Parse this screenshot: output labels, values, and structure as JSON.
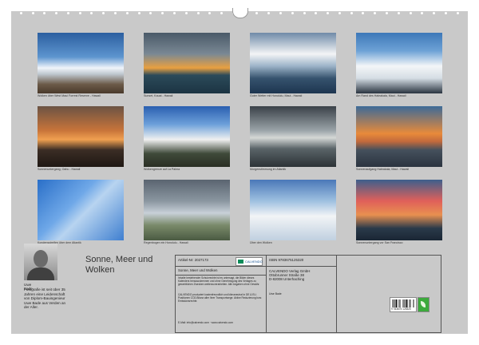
{
  "photos": [
    {
      "caption": "Wolken über West Maui Forrest Reserve - Hawaii"
    },
    {
      "caption": "Sunset, Kauai - Hawaii"
    },
    {
      "caption": "Guter Wetter mit Honolulu, Maui - Hawaii"
    },
    {
      "caption": "Am Rand des Haleakala, Maui - Hawaii"
    },
    {
      "caption": "Sonnenuntergang, Oahu - Hawaii"
    },
    {
      "caption": "Wolkengrenze auf La Palma"
    },
    {
      "caption": "Morgenstimmung im Atlantik"
    },
    {
      "caption": "Sonnenaufgang Haleakala, Maui - Hawaii"
    },
    {
      "caption": "Kondensstreifen über dem Atlantik"
    },
    {
      "caption": "Regenbogen ein Honolulu - Hawaii"
    },
    {
      "caption": "Über den Wolken"
    },
    {
      "caption": "Sonnenuntergang vor San Francisco"
    }
  ],
  "author": {
    "name": "Uwe Bade",
    "bio": "Fotografie ist seit über 35 Jahren eine Leidenschaft von Diplom-Bauingenieur Uwe Bade aus Verden an der Aller."
  },
  "calendar_title": "Sonne, Meer und Wolken",
  "info": {
    "article_no": "Artikel-Nr: 2027173",
    "logo_text": "CALVENDO",
    "subtitle": "Sonne, Meer und Wolken",
    "copyright_text": "Inhalte bestehender Schutzrechte ist es untersagt, die Bilder dieses Kalenders herauszutrennen und ohne Genehmigung des Verlages zu gewerblichen Zwecken weiterzuverarbeiten. Alle Angaben ohne Gewähr.",
    "eco_text": "CALVENDO produziert kostenfreundlich und klimaneutral in DE & EU. Positionen CO2-Bilanz aller Ihrer Transportwege. Aktive Reduzierung bzw. Emissionsrechte.",
    "email": "E-Mail: info@calvendo.com · www.calvendo.com",
    "isbn": "ISBN 9783675125320",
    "publisher_name": "CALVENDO Verlag GmbH",
    "publisher_street": "Ottobrunner Straße 38",
    "publisher_city": "D-82008 Unterhaching",
    "author_name": "Uwe Bade",
    "barcode_number": "9 783675 125320"
  },
  "colors": {
    "page_bg": "#c9c9c9",
    "logo_green": "#0a8c5a",
    "leaf_green": "#3caa3c"
  }
}
